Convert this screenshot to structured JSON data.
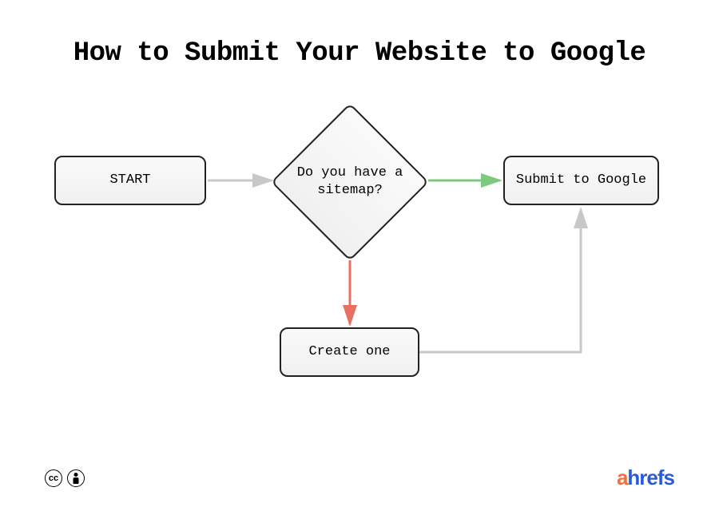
{
  "title": "How to Submit Your Website to Google",
  "nodes": {
    "start": "START",
    "decision": "Do you have a sitemap?",
    "create": "Create one",
    "submit": "Submit to Google"
  },
  "edges": {
    "yes_color": "#7fc97f",
    "no_color": "#e77062",
    "neutral_color": "#c8c8c8"
  },
  "footer": {
    "cc_label": "cc",
    "brand_prefix": "a",
    "brand_rest": "hrefs"
  }
}
